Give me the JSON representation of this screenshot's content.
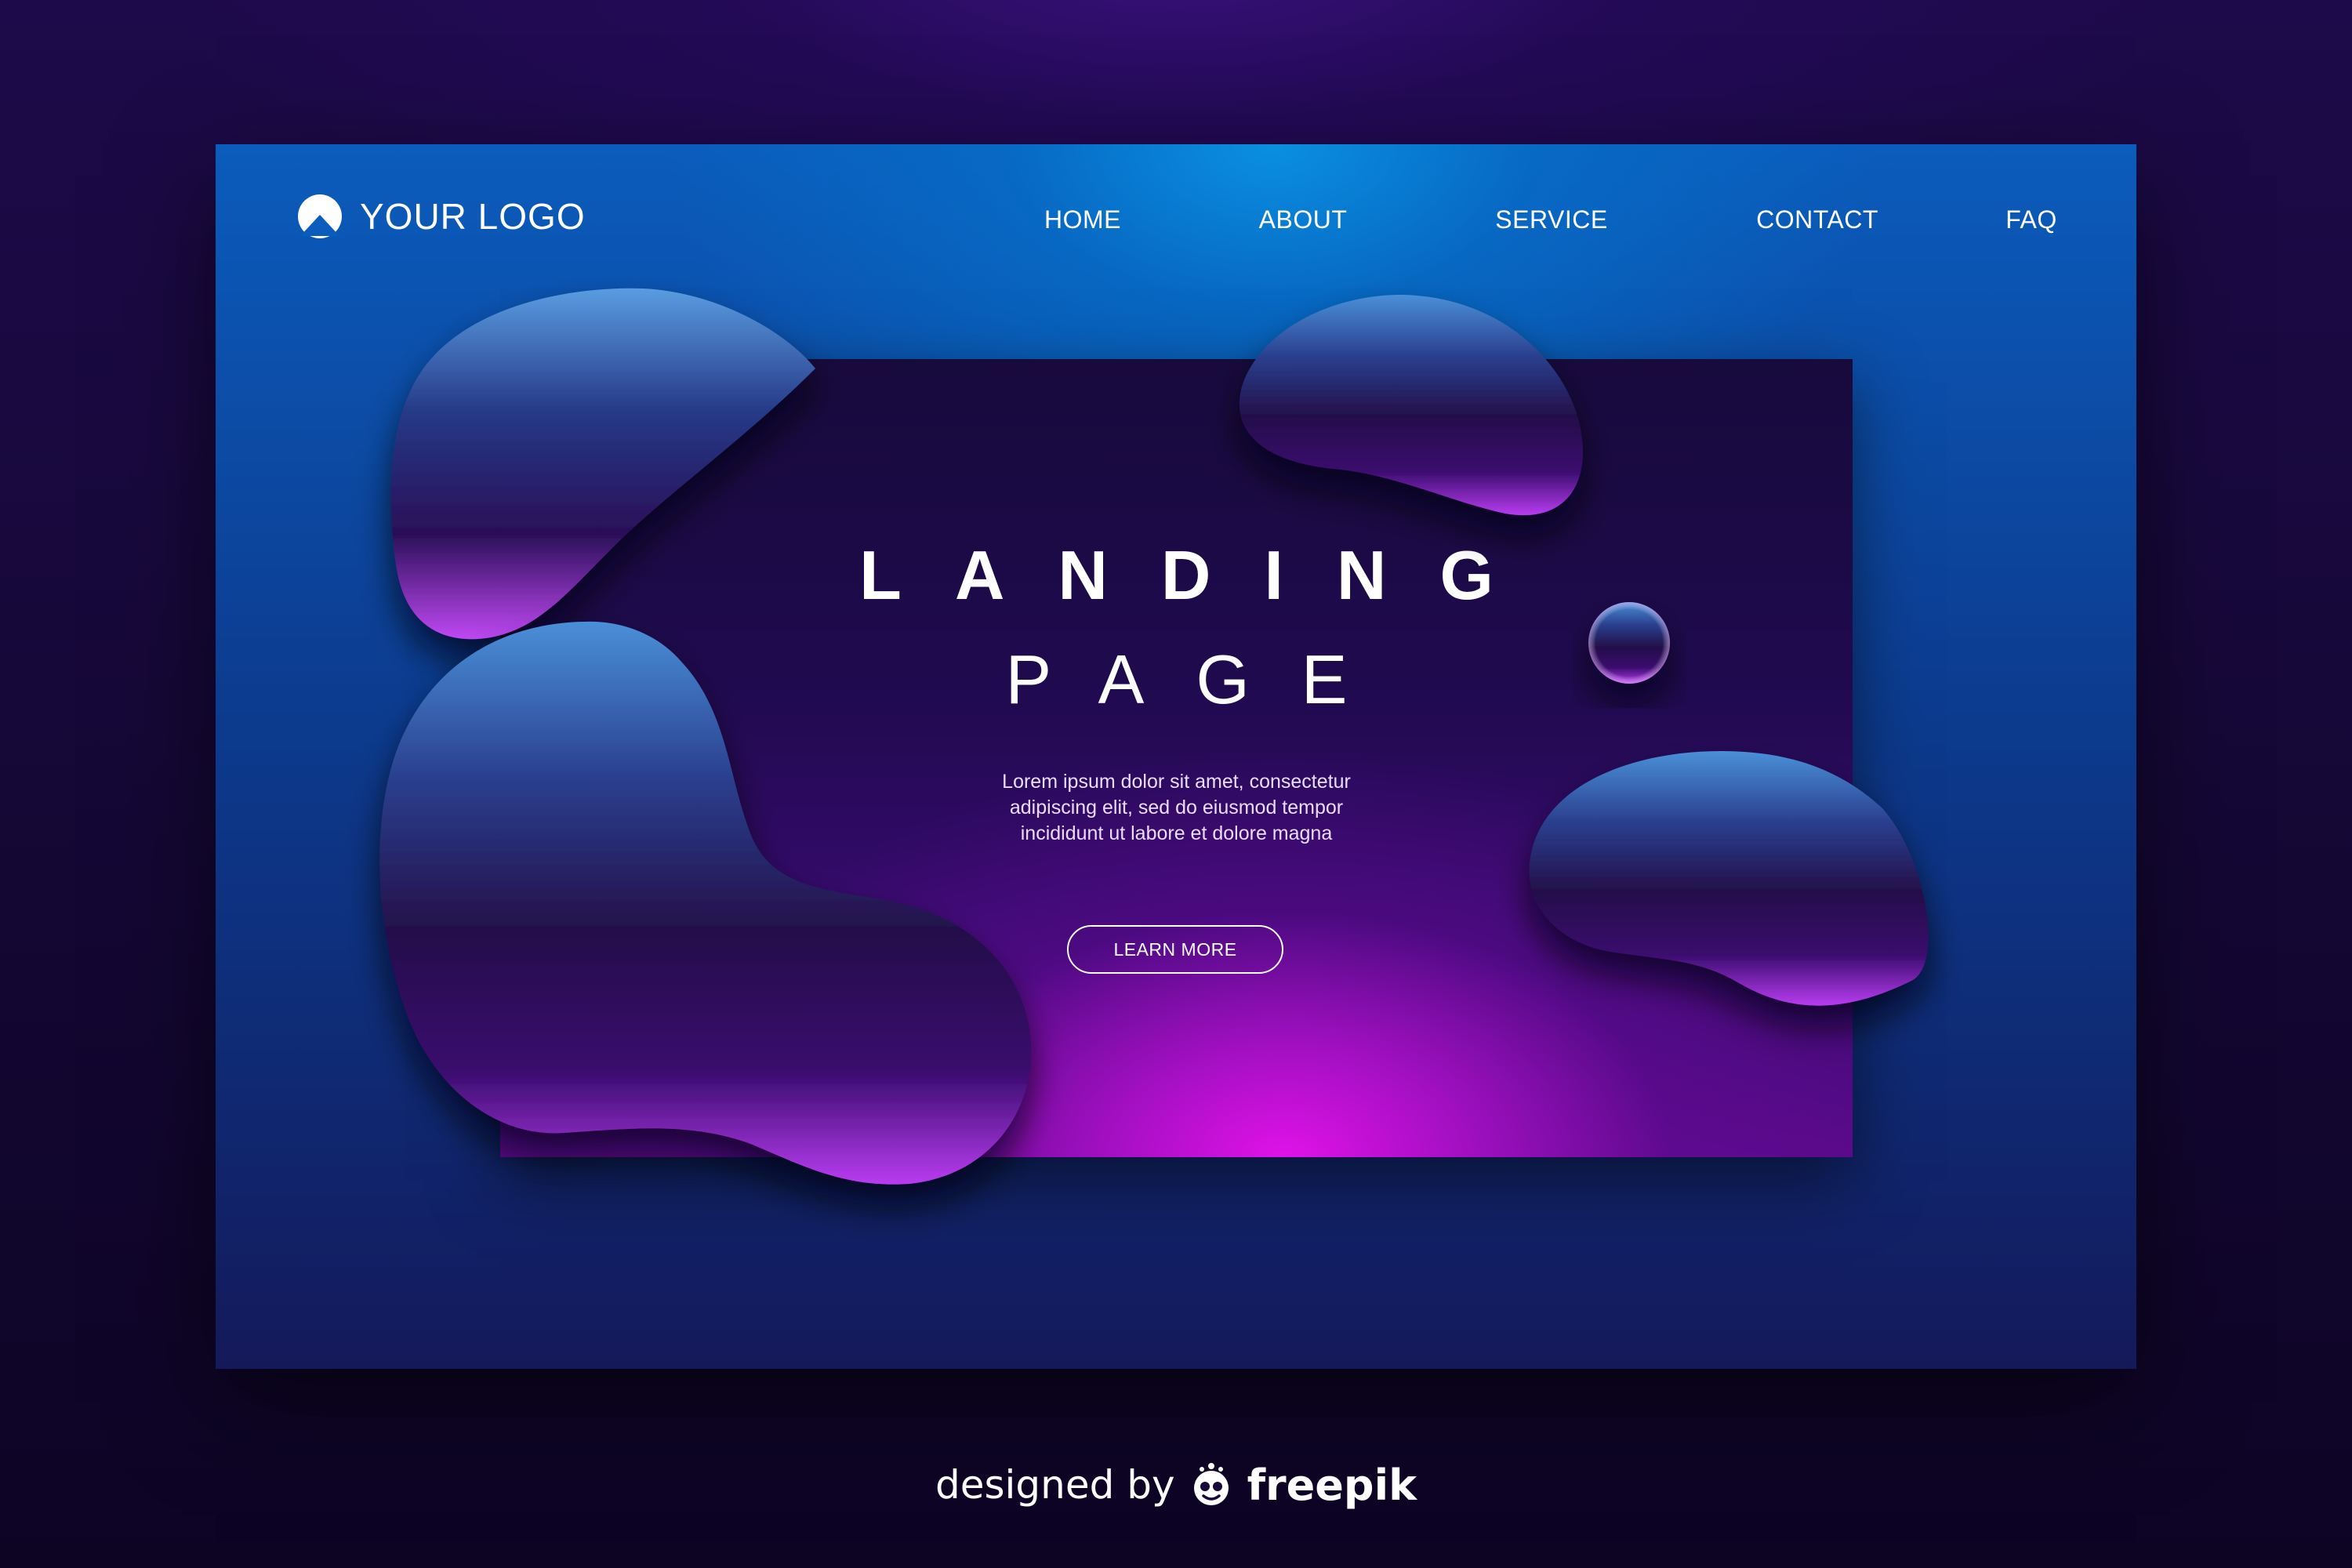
{
  "header": {
    "logo_text": "YOUR LOGO",
    "logo_icon": "mountain-arch-icon"
  },
  "nav": {
    "items": [
      {
        "label": "HOME"
      },
      {
        "label": "ABOUT"
      },
      {
        "label": "SERVICE"
      },
      {
        "label": "CONTACT"
      },
      {
        "label": "FAQ"
      }
    ]
  },
  "hero": {
    "title": "LANDING",
    "subtitle": "PAGE",
    "body_lines": [
      "Lorem ipsum dolor sit amet, consectetur",
      "adipiscing elit, sed do eiusmod tempor",
      "incididunt ut labore et dolore magna"
    ],
    "cta_label": "LEARN MORE"
  },
  "credit": {
    "prefix": "designed by",
    "brand": "freepik",
    "icon": "freepik-mascot-icon"
  },
  "colors": {
    "background": "#160838",
    "card_top": "#0a8fe0",
    "card_bottom": "#14195a",
    "hero_glow": "#e012e8",
    "blob_edge": "#c84cff",
    "text": "#ffffff"
  }
}
